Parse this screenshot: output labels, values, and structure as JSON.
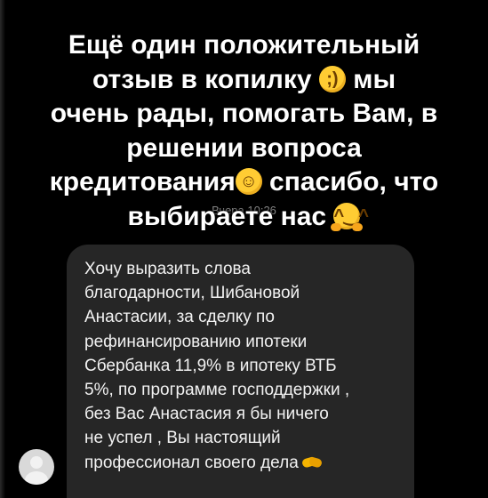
{
  "story": {
    "caption_lines": [
      "Ещё один положительный",
      "отзыв в копилку",
      "мы",
      "очень рады, помогать Вам, в",
      "решении вопроса",
      "кредитования",
      "спасибо, что",
      "выбираете нас"
    ],
    "emojis": [
      "winking-face-emoji",
      "smiling-face-emoji",
      "hugging-face-emoji"
    ]
  },
  "message": {
    "timestamp": "Вчера 10:26",
    "lines": [
      "Хочу выразить слова",
      "благодарности, Шибановой",
      "Анастасии, за сделку по",
      "рефинансированию ипотеки",
      "Сбербанка 11,9% в ипотеку ВТБ",
      "5%, по программе господдержки ,",
      "без Вас Анастасия я бы ничего",
      "не успел , Вы настоящий",
      "профессионал своего дела"
    ],
    "end_emoji": "handshake-emoji"
  },
  "colors": {
    "background": "#000000",
    "bubble": "#262626",
    "caption_text": "#ffffff",
    "message_text": "#f2f2f2",
    "timestamp_text": "#8b8b8b",
    "emoji_yellow": "#ffcc33"
  }
}
